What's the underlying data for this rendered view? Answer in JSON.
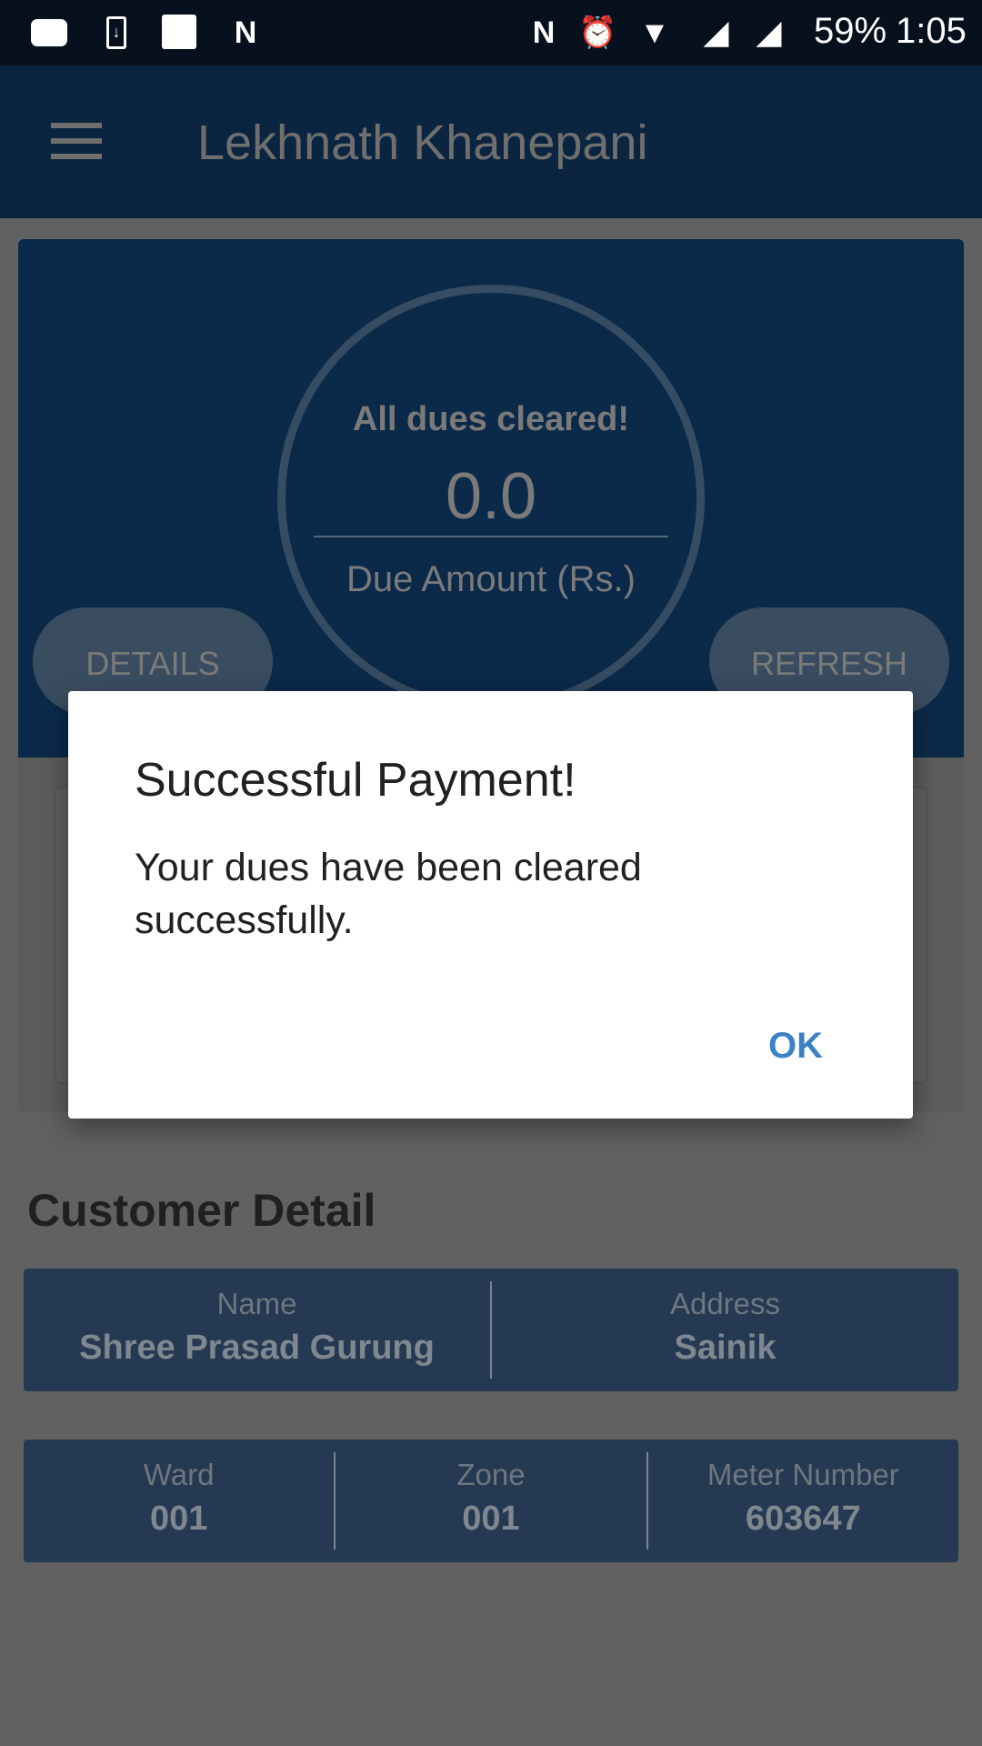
{
  "status_bar": {
    "battery": "59%",
    "time": "1:05",
    "left_icons": [
      "youtube-icon",
      "download-icon",
      "image-icon",
      "n-icon"
    ],
    "right_icons": [
      "nfc-icon",
      "alarm-icon",
      "wifi-icon",
      "signal-x-icon",
      "signal-icon"
    ]
  },
  "app_bar": {
    "title": "Lekhnath Khanepani",
    "menu_icon": "hamburger-icon"
  },
  "due_card": {
    "status": "All dues cleared!",
    "amount": "0.0",
    "label": "Due Amount (Rs.)",
    "details_button": "DETAILS",
    "refresh_button": "REFRESH"
  },
  "customer": {
    "title": "Customer Detail",
    "row1": [
      {
        "label": "Name",
        "value": "Shree Prasad Gurung"
      },
      {
        "label": "Address",
        "value": "Sainik"
      }
    ],
    "row2": [
      {
        "label": "Ward",
        "value": "001"
      },
      {
        "label": "Zone",
        "value": "001"
      },
      {
        "label": "Meter Number",
        "value": "603647"
      }
    ]
  },
  "dialog": {
    "title": "Successful Payment!",
    "message": "Your dues have been cleared successfully.",
    "ok_button": "OK"
  },
  "colors": {
    "app_bar": "#0b2540",
    "card": "#0b2a4a",
    "accent": "#3b82c4",
    "detail_box": "#253a52"
  }
}
